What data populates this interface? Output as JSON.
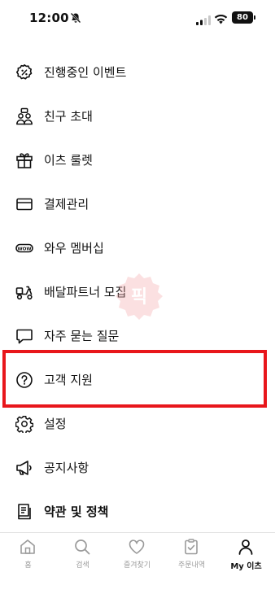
{
  "status_bar": {
    "time": "12:00",
    "battery": "80"
  },
  "menu": {
    "items": [
      {
        "label": "진행중인 이벤트",
        "icon": "discount-badge-icon"
      },
      {
        "label": "친구 초대",
        "icon": "invite-friends-icon"
      },
      {
        "label": "이츠 룰렛",
        "icon": "gift-box-icon"
      },
      {
        "label": "결제관리",
        "icon": "credit-card-icon"
      },
      {
        "label": "와우 멤버십",
        "icon": "wow-badge-icon"
      },
      {
        "label": "배달파트너 모집",
        "icon": "delivery-scooter-icon"
      },
      {
        "label": "자주 묻는 질문",
        "icon": "chat-bubble-icon"
      },
      {
        "label": "고객 지원",
        "icon": "question-circle-icon"
      },
      {
        "label": "설정",
        "icon": "gear-icon"
      },
      {
        "label": "공지사항",
        "icon": "megaphone-icon"
      },
      {
        "label": "약관 및 정책",
        "icon": "document-icon"
      }
    ]
  },
  "highlight_color": "#e8161b",
  "bottom_nav": {
    "items": [
      {
        "label": "홈",
        "icon": "home-icon"
      },
      {
        "label": "검색",
        "icon": "search-icon"
      },
      {
        "label": "즐겨찾기",
        "icon": "heart-icon"
      },
      {
        "label": "주문내역",
        "icon": "order-clipboard-icon"
      },
      {
        "label": "My 이츠",
        "icon": "person-icon",
        "active": true
      }
    ]
  }
}
